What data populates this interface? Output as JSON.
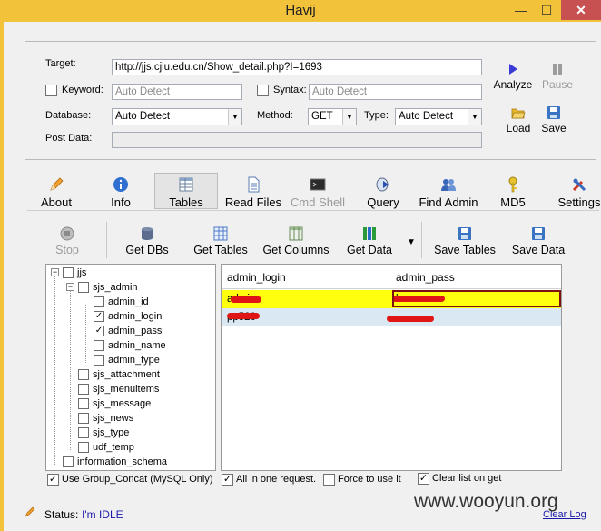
{
  "window": {
    "title": "Havij",
    "min": "—",
    "max": "☐",
    "close": "✕"
  },
  "target": {
    "target_label": "Target:",
    "target_value": "http://jjs.cjlu.edu.cn/Show_detail.php?I=1693",
    "keyword_label": "Keyword:",
    "keyword_placeholder": "Auto Detect",
    "syntax_label": "Syntax:",
    "syntax_placeholder": "Auto Detect",
    "database_label": "Database:",
    "database_value": "Auto Detect",
    "method_label": "Method:",
    "method_value": "GET",
    "type_label": "Type:",
    "type_value": "Auto Detect",
    "postdata_label": "Post Data:",
    "analyze": "Analyze",
    "pause": "Pause",
    "load": "Load",
    "save": "Save"
  },
  "tabs": [
    "About",
    "Info",
    "Tables",
    "Read Files",
    "Cmd Shell",
    "Query",
    "Find Admin",
    "MD5",
    "Settings"
  ],
  "toolbar": {
    "stop": "Stop",
    "get_dbs": "Get DBs",
    "get_tables": "Get Tables",
    "get_columns": "Get Columns",
    "get_data": "Get Data",
    "save_tables": "Save Tables",
    "save_data": "Save Data"
  },
  "tree": {
    "root": "jjs",
    "db": "sjs_admin",
    "columns": [
      {
        "name": "admin_id",
        "checked": false
      },
      {
        "name": "admin_login",
        "checked": true
      },
      {
        "name": "admin_pass",
        "checked": true
      },
      {
        "name": "admin_name",
        "checked": false
      },
      {
        "name": "admin_type",
        "checked": false
      }
    ],
    "tables": [
      "sjs_attachment",
      "sjs_menuitems",
      "sjs_message",
      "sjs_news",
      "sjs_type",
      "udf_temp"
    ],
    "schema": "information_schema"
  },
  "grid": {
    "headers": [
      "admin_login",
      "admin_pass"
    ],
    "rows": [
      [
        "admin",
        "b"
      ],
      [
        "pp520",
        ""
      ]
    ]
  },
  "options": {
    "group_concat": "Use Group_Concat (MySQL Only)",
    "all_in_one": "All in one request.",
    "force": "Force to use it",
    "clear_list": "Clear list on get"
  },
  "status": {
    "label": "Status:",
    "value": "I'm IDLE",
    "clear_log": "Clear Log"
  },
  "watermark": "www.wooyun.org",
  "colors": {
    "title_bar": "#f2c23b",
    "selected_row": "#ffff0e",
    "second_row": "#d9e8f3",
    "status_value": "#1a1aa8",
    "selection_border": "#7d1010"
  }
}
